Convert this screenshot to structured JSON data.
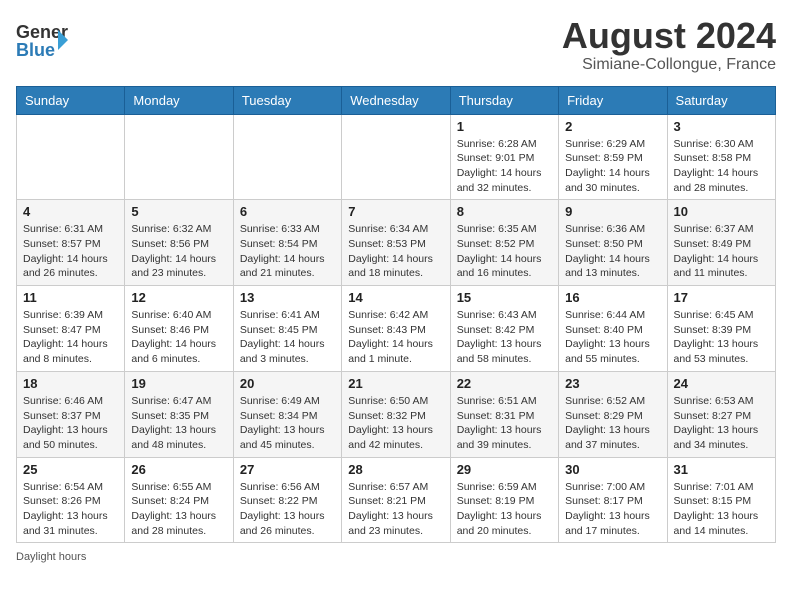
{
  "header": {
    "logo_general": "General",
    "logo_blue": "Blue",
    "month_year": "August 2024",
    "subtitle": "Simiane-Collongue, France"
  },
  "days_of_week": [
    "Sunday",
    "Monday",
    "Tuesday",
    "Wednesday",
    "Thursday",
    "Friday",
    "Saturday"
  ],
  "weeks": [
    [
      {
        "day": "",
        "info": ""
      },
      {
        "day": "",
        "info": ""
      },
      {
        "day": "",
        "info": ""
      },
      {
        "day": "",
        "info": ""
      },
      {
        "day": "1",
        "info": "Sunrise: 6:28 AM\nSunset: 9:01 PM\nDaylight: 14 hours and 32 minutes."
      },
      {
        "day": "2",
        "info": "Sunrise: 6:29 AM\nSunset: 8:59 PM\nDaylight: 14 hours and 30 minutes."
      },
      {
        "day": "3",
        "info": "Sunrise: 6:30 AM\nSunset: 8:58 PM\nDaylight: 14 hours and 28 minutes."
      }
    ],
    [
      {
        "day": "4",
        "info": "Sunrise: 6:31 AM\nSunset: 8:57 PM\nDaylight: 14 hours and 26 minutes."
      },
      {
        "day": "5",
        "info": "Sunrise: 6:32 AM\nSunset: 8:56 PM\nDaylight: 14 hours and 23 minutes."
      },
      {
        "day": "6",
        "info": "Sunrise: 6:33 AM\nSunset: 8:54 PM\nDaylight: 14 hours and 21 minutes."
      },
      {
        "day": "7",
        "info": "Sunrise: 6:34 AM\nSunset: 8:53 PM\nDaylight: 14 hours and 18 minutes."
      },
      {
        "day": "8",
        "info": "Sunrise: 6:35 AM\nSunset: 8:52 PM\nDaylight: 14 hours and 16 minutes."
      },
      {
        "day": "9",
        "info": "Sunrise: 6:36 AM\nSunset: 8:50 PM\nDaylight: 14 hours and 13 minutes."
      },
      {
        "day": "10",
        "info": "Sunrise: 6:37 AM\nSunset: 8:49 PM\nDaylight: 14 hours and 11 minutes."
      }
    ],
    [
      {
        "day": "11",
        "info": "Sunrise: 6:39 AM\nSunset: 8:47 PM\nDaylight: 14 hours and 8 minutes."
      },
      {
        "day": "12",
        "info": "Sunrise: 6:40 AM\nSunset: 8:46 PM\nDaylight: 14 hours and 6 minutes."
      },
      {
        "day": "13",
        "info": "Sunrise: 6:41 AM\nSunset: 8:45 PM\nDaylight: 14 hours and 3 minutes."
      },
      {
        "day": "14",
        "info": "Sunrise: 6:42 AM\nSunset: 8:43 PM\nDaylight: 14 hours and 1 minute."
      },
      {
        "day": "15",
        "info": "Sunrise: 6:43 AM\nSunset: 8:42 PM\nDaylight: 13 hours and 58 minutes."
      },
      {
        "day": "16",
        "info": "Sunrise: 6:44 AM\nSunset: 8:40 PM\nDaylight: 13 hours and 55 minutes."
      },
      {
        "day": "17",
        "info": "Sunrise: 6:45 AM\nSunset: 8:39 PM\nDaylight: 13 hours and 53 minutes."
      }
    ],
    [
      {
        "day": "18",
        "info": "Sunrise: 6:46 AM\nSunset: 8:37 PM\nDaylight: 13 hours and 50 minutes."
      },
      {
        "day": "19",
        "info": "Sunrise: 6:47 AM\nSunset: 8:35 PM\nDaylight: 13 hours and 48 minutes."
      },
      {
        "day": "20",
        "info": "Sunrise: 6:49 AM\nSunset: 8:34 PM\nDaylight: 13 hours and 45 minutes."
      },
      {
        "day": "21",
        "info": "Sunrise: 6:50 AM\nSunset: 8:32 PM\nDaylight: 13 hours and 42 minutes."
      },
      {
        "day": "22",
        "info": "Sunrise: 6:51 AM\nSunset: 8:31 PM\nDaylight: 13 hours and 39 minutes."
      },
      {
        "day": "23",
        "info": "Sunrise: 6:52 AM\nSunset: 8:29 PM\nDaylight: 13 hours and 37 minutes."
      },
      {
        "day": "24",
        "info": "Sunrise: 6:53 AM\nSunset: 8:27 PM\nDaylight: 13 hours and 34 minutes."
      }
    ],
    [
      {
        "day": "25",
        "info": "Sunrise: 6:54 AM\nSunset: 8:26 PM\nDaylight: 13 hours and 31 minutes."
      },
      {
        "day": "26",
        "info": "Sunrise: 6:55 AM\nSunset: 8:24 PM\nDaylight: 13 hours and 28 minutes."
      },
      {
        "day": "27",
        "info": "Sunrise: 6:56 AM\nSunset: 8:22 PM\nDaylight: 13 hours and 26 minutes."
      },
      {
        "day": "28",
        "info": "Sunrise: 6:57 AM\nSunset: 8:21 PM\nDaylight: 13 hours and 23 minutes."
      },
      {
        "day": "29",
        "info": "Sunrise: 6:59 AM\nSunset: 8:19 PM\nDaylight: 13 hours and 20 minutes."
      },
      {
        "day": "30",
        "info": "Sunrise: 7:00 AM\nSunset: 8:17 PM\nDaylight: 13 hours and 17 minutes."
      },
      {
        "day": "31",
        "info": "Sunrise: 7:01 AM\nSunset: 8:15 PM\nDaylight: 13 hours and 14 minutes."
      }
    ]
  ],
  "footer": {
    "daylight_label": "Daylight hours"
  }
}
